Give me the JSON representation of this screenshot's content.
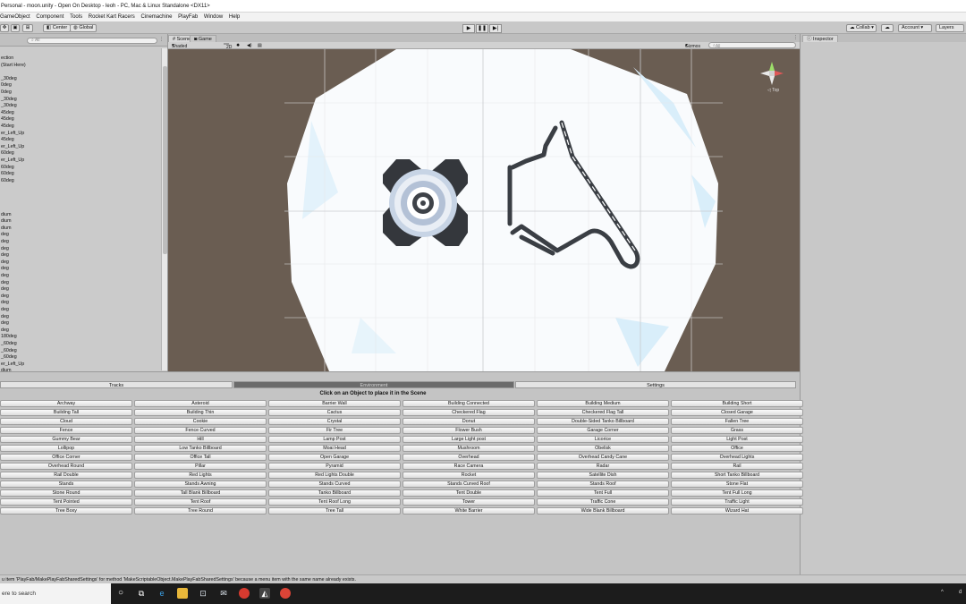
{
  "window": {
    "title": "Personal - moon.unity - Open On Desktop - leoh - PC, Mac & Linux Standalone <DX11>"
  },
  "menu": [
    "GameObject",
    "Component",
    "Tools",
    "Rocket Kart Racers",
    "Cinemachine",
    "PlayFab",
    "Window",
    "Help"
  ],
  "toolbar": {
    "center": "Center",
    "global": "Global",
    "play_icon": "play-icon",
    "pause_icon": "pause-icon",
    "step_icon": "step-icon",
    "collab": "Collab ▾",
    "account": "Account",
    "layers": "Layers"
  },
  "hierarchy": {
    "search_placeholder": "All",
    "items": [
      "ection",
      "(Start Here)",
      "",
      "_30deg",
      "0deg",
      "0deg",
      "_30deg",
      "_30deg",
      "45deg",
      "45deg",
      "45deg",
      "er_Left_Up",
      "45deg",
      "er_Left_Up",
      "60deg",
      "er_Left_Up",
      "60deg",
      "60deg",
      "60deg",
      "",
      "",
      "",
      "",
      "dium",
      "dium",
      "dium",
      "deg",
      "deg",
      "deg",
      "deg",
      "deg",
      "deg",
      "deg",
      "deg",
      "deg",
      "deg",
      "deg",
      "deg",
      "deg",
      "deg",
      "deg",
      "180deg",
      "_60deg",
      "_60deg",
      "_60deg",
      "er_Left_Up",
      "dium",
      "dium"
    ]
  },
  "scene": {
    "tabs": [
      "Scene",
      "Game"
    ],
    "shading": "Shaded",
    "mode_2d": "2D",
    "gizmos": "Gizmos",
    "search_placeholder": "All",
    "gizmo_label": "Top"
  },
  "inspector": {
    "tab": "Inspector"
  },
  "bottom": {
    "tabs": [
      "Tracks",
      "Environment",
      "Settings"
    ],
    "active_tab": "Environment",
    "instruction": "Click on an Object to place it in the Scene",
    "objects": [
      "Archway",
      "Asteroid",
      "Barrier Wall",
      "Building Connected",
      "Building Medium",
      "Building Short",
      "Building Tall",
      "Building Thin",
      "Cactus",
      "Checkered Flag",
      "Checkered Flag Tall",
      "Closed Garage",
      "Cloud",
      "Cookie",
      "Crystal",
      "Donut",
      "Double-Sided Tanko Billboard",
      "Fallen Tree",
      "Fence",
      "Fence Curved",
      "Fir Tree",
      "Flower Bush",
      "Garage Corner",
      "Grass",
      "Gummy Bear",
      "Hill",
      "Lamp Post",
      "Large Light post",
      "Licorice",
      "Light Post",
      "Lollipop",
      "Low Tanko Billboard",
      "Moai Head",
      "Mushroom",
      "Obelisk",
      "Office",
      "Office Corner",
      "Office Tall",
      "Open Garage",
      "Overhead",
      "Overhead Candy Cane",
      "Overhead Lights",
      "Overhead Round",
      "Pillar",
      "Pyramid",
      "Race Camera",
      "Radar",
      "Rail",
      "Rail Double",
      "Red Lights",
      "Red Lights Double",
      "Rocket",
      "Satellite Dish",
      "Short Tanko Billboard",
      "Stands",
      "Stands Awning",
      "Stands Curved",
      "Stands Curved Roof",
      "Stands Roof",
      "Stone Flat",
      "Stone Round",
      "Tall Blank Billboard",
      "Tanko Billboard",
      "Tent Double",
      "Tent Full",
      "Tent Full Long",
      "Tent Pointed",
      "Tent Roof",
      "Tent Roof Long",
      "Tower",
      "Traffic Cone",
      "Traffic Light",
      "Tree Boxy",
      "Tree Round",
      "Tree Tall",
      "White Barrier",
      "Wide Blank Billboard",
      "Wizard Hat"
    ]
  },
  "console": {
    "message": "u item 'PlayFab/MakePlayFabSharedSettings' for method 'MakeScriptableObject.MakePlayFabSharedSettings' because a menu item with the same name already exists."
  },
  "taskbar": {
    "search": "ere to search",
    "tray_text": "d",
    "icons": [
      "cortana-icon",
      "task-view-icon",
      "edge-icon",
      "file-explorer-icon",
      "store-icon",
      "mail-icon",
      "recorder-icon",
      "unity-icon",
      "chrome-icon"
    ]
  },
  "colors": {
    "viewport_bg": "#6a5d52",
    "track_dark": "#3a3e44",
    "active_tab": "#6b6b6b"
  }
}
